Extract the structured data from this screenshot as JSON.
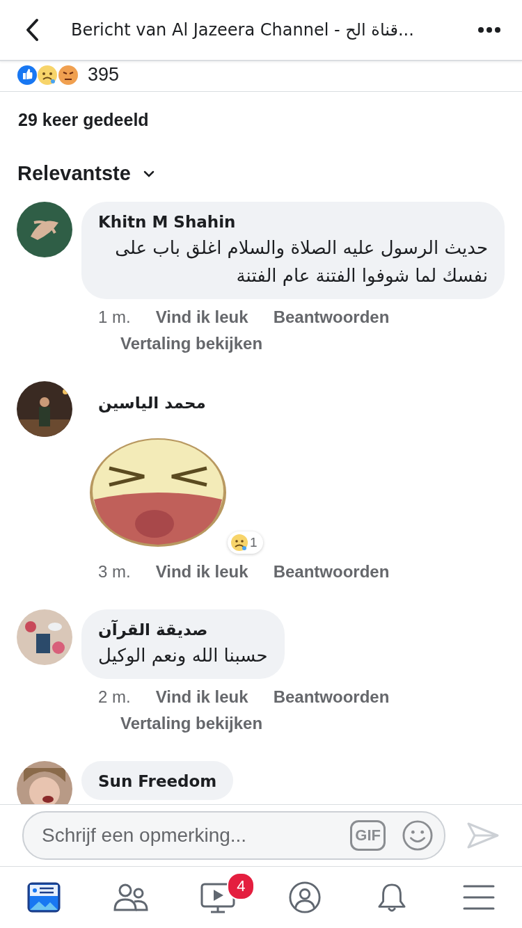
{
  "header": {
    "title": "Bericht van Al Jazeera Channel - قناة الح..."
  },
  "reactions": {
    "count": "395"
  },
  "shares": "29 keer gedeeld",
  "sort": {
    "label": "Relevantste"
  },
  "comments": [
    {
      "kind": "text",
      "author": "Khitn M Shahin",
      "text": "حديث الرسول عليه الصلاة والسلام اغلق باب على نفسك لما شوفوا الفتنة  عام الفتنة",
      "time": "1 m.",
      "like": "Vind ik leuk",
      "reply": "Beantwoorden",
      "translate": "Vertaling bekijken"
    },
    {
      "kind": "sticker",
      "author": "محمد الياسين",
      "reaction_count": "1",
      "time": "3 m.",
      "like": "Vind ik leuk",
      "reply": "Beantwoorden"
    },
    {
      "kind": "text",
      "author": "صديقة القرآن",
      "text": "حسبنا الله ونعم الوكيل",
      "time": "2 m.",
      "like": "Vind ik leuk",
      "reply": "Beantwoorden",
      "translate": "Vertaling bekijken"
    },
    {
      "kind": "text",
      "author": "Sun Freedom"
    }
  ],
  "composer": {
    "placeholder": "Schrijf een opmerking...",
    "gif": "GIF"
  },
  "tabs": [
    {
      "kind": "news",
      "selected": true
    },
    {
      "kind": "friends",
      "selected": false
    },
    {
      "kind": "video",
      "selected": false,
      "badge": "4"
    },
    {
      "kind": "profile",
      "selected": false
    },
    {
      "kind": "bell",
      "selected": false
    },
    {
      "kind": "menu",
      "selected": false
    }
  ]
}
